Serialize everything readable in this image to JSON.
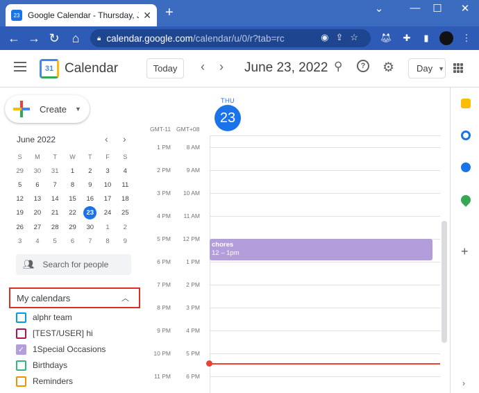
{
  "browser": {
    "tab_title": "Google Calendar - Thursday, June",
    "favicon_text": "23",
    "tab_close": "✕",
    "new_tab": "+",
    "window_controls": {
      "chevron": "⌄",
      "minimize": "—",
      "maximize": "☐",
      "close": "✕"
    },
    "nav": {
      "back": "←",
      "forward": "→",
      "reload": "↻",
      "home": "⌂"
    },
    "url_host": "calendar.google.com",
    "url_path": "/calendar/u/0/r?tab=rc"
  },
  "header": {
    "app_name": "Calendar",
    "icon_day": "31",
    "today_label": "Today",
    "date_title": "June 23, 2022",
    "view_label": "Day"
  },
  "sidebar": {
    "create_label": "Create",
    "mini_month": "June 2022",
    "weekdays": [
      "S",
      "M",
      "T",
      "W",
      "T",
      "F",
      "S"
    ],
    "weeks": [
      [
        {
          "d": "29",
          "out": true
        },
        {
          "d": "30",
          "out": true
        },
        {
          "d": "31",
          "out": true
        },
        {
          "d": "1"
        },
        {
          "d": "2"
        },
        {
          "d": "3"
        },
        {
          "d": "4"
        }
      ],
      [
        {
          "d": "5"
        },
        {
          "d": "6"
        },
        {
          "d": "7"
        },
        {
          "d": "8"
        },
        {
          "d": "9"
        },
        {
          "d": "10"
        },
        {
          "d": "11"
        }
      ],
      [
        {
          "d": "12"
        },
        {
          "d": "13"
        },
        {
          "d": "14"
        },
        {
          "d": "15"
        },
        {
          "d": "16"
        },
        {
          "d": "17"
        },
        {
          "d": "18"
        }
      ],
      [
        {
          "d": "19"
        },
        {
          "d": "20"
        },
        {
          "d": "21"
        },
        {
          "d": "22"
        },
        {
          "d": "23",
          "sel": true
        },
        {
          "d": "24"
        },
        {
          "d": "25"
        }
      ],
      [
        {
          "d": "26"
        },
        {
          "d": "27"
        },
        {
          "d": "28"
        },
        {
          "d": "29"
        },
        {
          "d": "30"
        },
        {
          "d": "1",
          "out": true
        },
        {
          "d": "2",
          "out": true
        }
      ],
      [
        {
          "d": "3",
          "out": true
        },
        {
          "d": "4",
          "out": true
        },
        {
          "d": "5",
          "out": true
        },
        {
          "d": "6",
          "out": true
        },
        {
          "d": "7",
          "out": true
        },
        {
          "d": "8",
          "out": true
        },
        {
          "d": "9",
          "out": true
        }
      ]
    ],
    "search_placeholder": "Search for people",
    "my_calendars_label": "My calendars",
    "calendars": [
      {
        "name": "alphr team",
        "color": "#039be5",
        "checked": false
      },
      {
        "name": "[TEST/USER] hi",
        "color": "#ad1457",
        "checked": false
      },
      {
        "name": "1Special Occasions",
        "color": "#b39ddb",
        "checked": true
      },
      {
        "name": "Birthdays",
        "color": "#33b679",
        "checked": false
      },
      {
        "name": "Reminders",
        "color": "#f09300",
        "checked": false
      }
    ]
  },
  "day_view": {
    "weekday": "THU",
    "day_number": "23",
    "tz_primary": "GMT-11",
    "tz_secondary": "GMT+08",
    "times_primary": [
      "1 PM",
      "2 PM",
      "3 PM",
      "4 PM",
      "5 PM",
      "6 PM",
      "7 PM",
      "8 PM",
      "9 PM",
      "10 PM",
      "11 PM"
    ],
    "times_secondary": [
      "8 AM",
      "9 AM",
      "10 AM",
      "11 AM",
      "12 PM",
      "1 PM",
      "2 PM",
      "3 PM",
      "4 PM",
      "5 PM",
      "6 PM"
    ],
    "event": {
      "title": "chores",
      "time": "12 – 1pm",
      "color": "#b39ddb"
    }
  },
  "colors": {
    "accent": "#1a73e8",
    "now_line": "#ea4335",
    "browser_blue": "#3c6cc0"
  }
}
